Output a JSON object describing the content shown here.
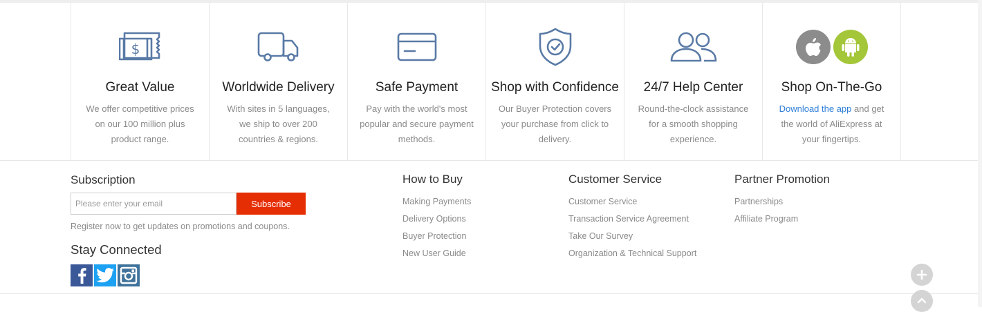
{
  "features": [
    {
      "icon": "money-ticket-icon",
      "title": "Great Value",
      "desc": "We offer competitive prices on our 100 million plus product range."
    },
    {
      "icon": "delivery-truck-icon",
      "title": "Worldwide Delivery",
      "desc": "With sites in 5 languages, we ship to over 200 countries & regions."
    },
    {
      "icon": "credit-card-icon",
      "title": "Safe Payment",
      "desc": "Pay with the world's most popular and secure payment methods."
    },
    {
      "icon": "shield-check-icon",
      "title": "Shop with Confidence",
      "desc": "Our Buyer Protection covers your purchase from click to delivery."
    },
    {
      "icon": "users-icon",
      "title": "24/7 Help Center",
      "desc": "Round-the-clock assistance for a smooth shopping experience."
    },
    {
      "icon": "app-store-icons",
      "title": "Shop On-The-Go",
      "desc_link": "Download the app",
      "desc_rest": " and get the world of AliExpress at your fingertips."
    }
  ],
  "subscription": {
    "title": "Subscription",
    "placeholder": "Please enter your email",
    "button": "Subscribe",
    "note": "Register now to get updates on promotions and coupons."
  },
  "stay_connected": {
    "title": "Stay Connected",
    "networks": [
      "facebook-icon",
      "twitter-icon",
      "instagram-icon"
    ]
  },
  "columns": [
    {
      "title": "How to Buy",
      "links": [
        "Making Payments",
        "Delivery Options",
        "Buyer Protection",
        "New User Guide"
      ]
    },
    {
      "title": "Customer Service",
      "links": [
        "Customer Service",
        "Transaction Service Agreement",
        "Take Our Survey",
        "Organization & Technical Support"
      ]
    },
    {
      "title": "Partner Promotion",
      "links": [
        "Partnerships",
        "Affiliate Program"
      ]
    }
  ],
  "colors": {
    "accent": "#e62e04",
    "icon": "#5a7aa6",
    "link": "#2f7fd8",
    "apple": "#8c8c8c",
    "android": "#a4c639",
    "facebook": "#3b5998",
    "twitter": "#1da1f2",
    "instagram": "#3f729b"
  }
}
